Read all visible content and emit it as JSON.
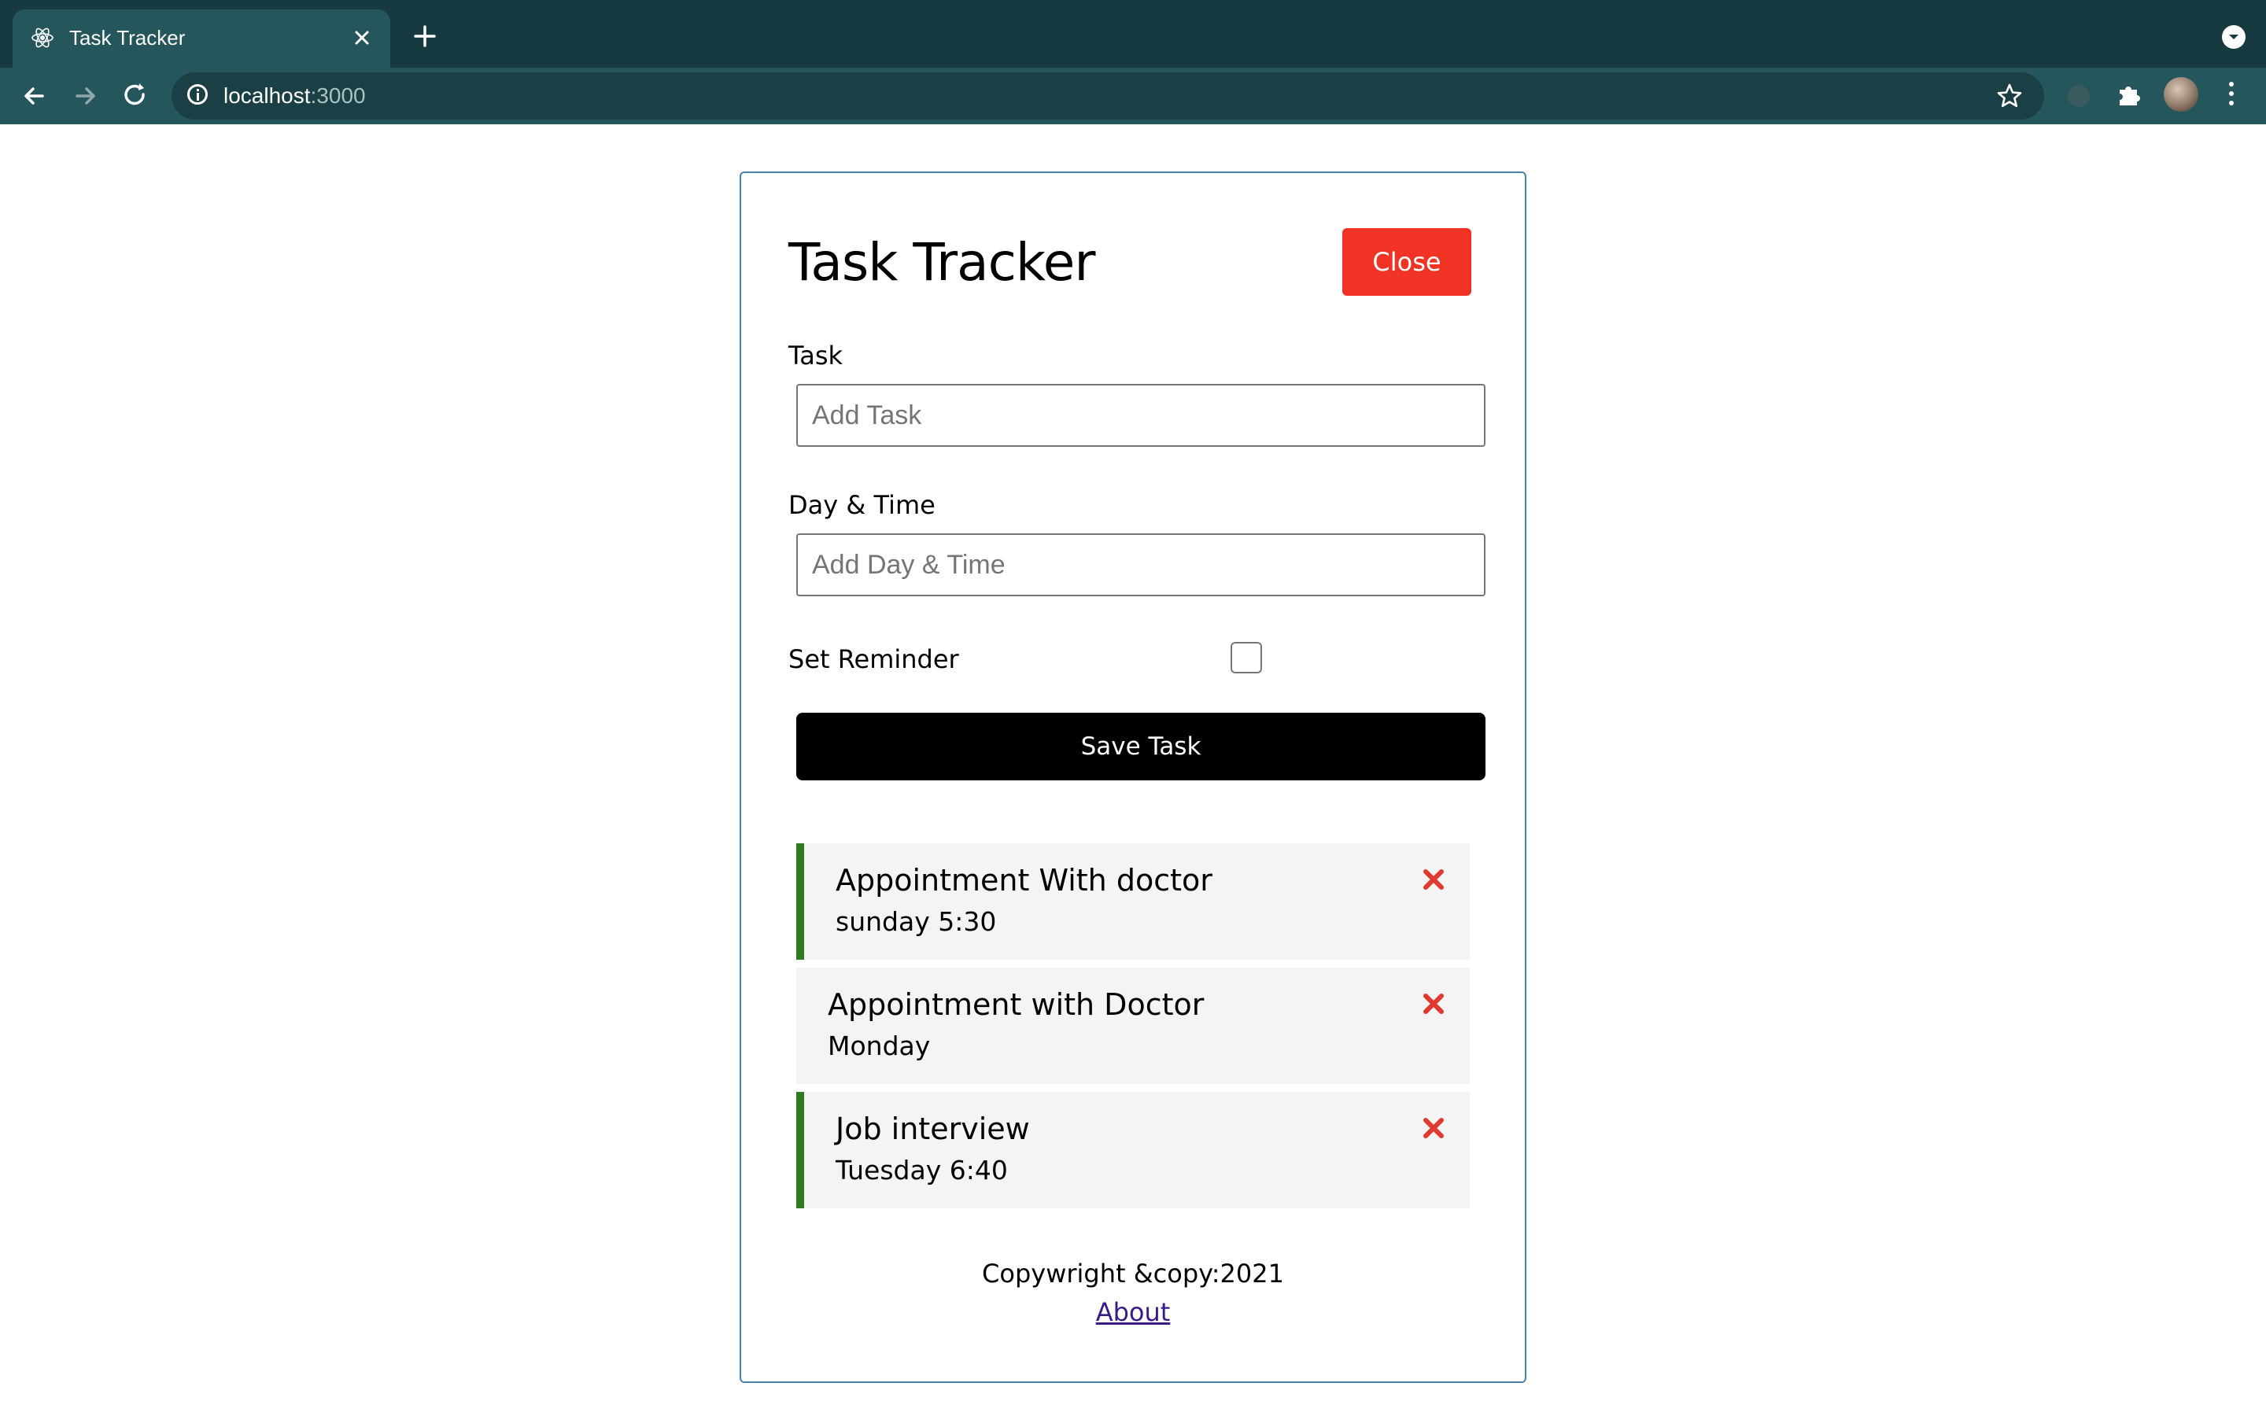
{
  "browser": {
    "tab_title": "Task Tracker",
    "url_host": "localhost",
    "url_port": ":3000",
    "icons": {
      "favicon": "react-logo-icon",
      "tab_close": "close-icon",
      "new_tab": "plus-icon",
      "tab_search": "chevron-down-icon",
      "back": "arrow-left-icon",
      "forward": "arrow-right-icon",
      "reload": "reload-icon",
      "site_info": "info-icon",
      "bookmark": "star-icon",
      "extension": "puzzle-icon",
      "menu": "more-vertical-icon"
    }
  },
  "app": {
    "title": "Task Tracker",
    "close_label": "Close",
    "form": {
      "task_label": "Task",
      "task_placeholder": "Add Task",
      "task_value": "",
      "day_label": "Day & Time",
      "day_placeholder": "Add Day & Time",
      "day_value": "",
      "reminder_label": "Set Reminder",
      "reminder_checked": false,
      "save_label": "Save Task"
    },
    "tasks": [
      {
        "text": "Appointment With doctor",
        "day": "sunday 5:30",
        "reminder": true
      },
      {
        "text": "Appointment with Doctor",
        "day": "Monday",
        "reminder": false
      },
      {
        "text": "Job interview",
        "day": "Tuesday 6:40",
        "reminder": true
      }
    ],
    "footer": {
      "copyright": "Copywright &copy:2021",
      "about_link": "About"
    }
  },
  "colors": {
    "close_button": "#f03325",
    "save_button": "#000000",
    "reminder_border": "#2b7d1f",
    "delete_icon": "#e03a2e",
    "task_background": "#f4f4f4",
    "card_border": "#4a7fa8",
    "chrome_dark": "#163a40",
    "chrome_toolbar": "#24565c"
  }
}
